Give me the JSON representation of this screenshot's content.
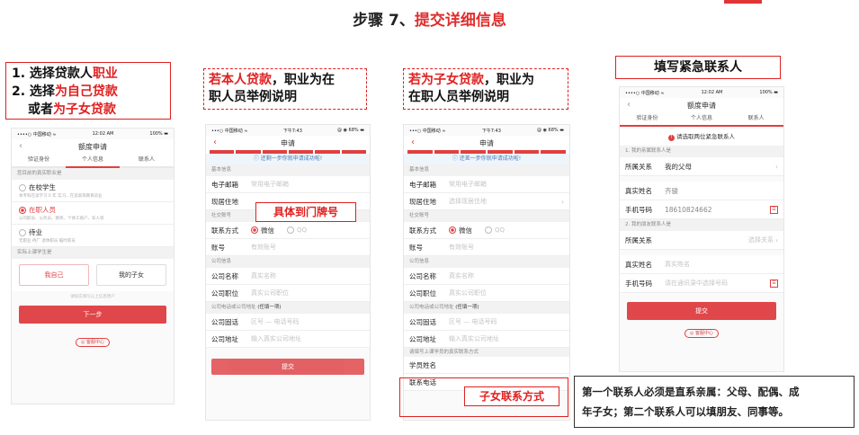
{
  "header": {
    "step": "步骤 7、",
    "title": "提交详细信息"
  },
  "callouts": {
    "c1_line1_pre": "1. 选择贷款人",
    "c1_line1_red": "职业",
    "c1_line2_pre": "2. 选择",
    "c1_line2_red": "为自己贷款",
    "c1_line3_pre": "或者",
    "c1_line3_red": "为子女贷款",
    "c2_red": "若本人贷款",
    "c2_rest1": "，职业为在",
    "c2_rest2": "职人员举例说明",
    "c3_red": "若为子女贷款",
    "c3_rest1": "，职业为",
    "c3_rest2": "在职人员举例说明",
    "c4": "填写紧急联系人",
    "address_hint": "具体到门牌号",
    "child_contact_hint": "子女联系方式",
    "note_line1": "第一个联系人必须是直系亲属：父母、配偶、成",
    "note_line2": "年子女；第二个联系人可以填朋友、同事等。"
  },
  "phone1": {
    "status_carrier": "••••○ 中国移动 ≈",
    "status_time": "12:02 AM",
    "status_battery": "100% ▬",
    "nav_title": "额度申请",
    "tabs": [
      "验证身份",
      "个人信息",
      "联系人"
    ],
    "section1": "您目前的真实职业是",
    "options": [
      {
        "title": "在校学生",
        "sub": "本专科在读学习 0 年   实习、在读高等教育毕业"
      },
      {
        "title": "在职人员",
        "sub": "公司职员、公务员、教师、个体工商户、军人等"
      },
      {
        "title": "待业",
        "sub": "无职业 待厂 退休职员 临时职员"
      }
    ],
    "section2": "实际上课学生是",
    "choice_self": "我自己",
    "choice_child": "我的子女",
    "small_hint": "请如实填写以上信息用户",
    "next_button": "下一步",
    "help": "◎ 客服中心"
  },
  "phone2": {
    "status_left": "•••○ 中国移动 ≈",
    "status_time": "下午7:43",
    "status_right": "@ ◉ 68% ▬",
    "nav_title": "申请",
    "notice": "ⓘ 还剩一步你就申请成功啦!",
    "sec_basic": "基本信息",
    "email_label": "电子邮箱",
    "email_ph": "常用电子邮箱",
    "address_label": "现居住地",
    "sec_social": "社交账号",
    "contact_label": "联系方式",
    "wechat": "微信",
    "qq": "QQ",
    "account_label": "账号",
    "account_ph": "有效账号",
    "sec_company": "公司信息",
    "company_name_label": "公司名称",
    "company_name_ph": "真实名称",
    "company_pos_label": "公司职位",
    "company_pos_ph": "真实公司职位",
    "sec_company_phone": "公司电话或公司地址",
    "sec_company_phone_tag": "(任填一项)",
    "company_tel_label": "公司固话",
    "company_tel_ph": "区号 — 电话号码",
    "company_addr_label": "公司地址",
    "company_addr_ph": "输入真实公司地址",
    "submit": "提交"
  },
  "phone3": {
    "status_left": "•••○ 中国移动 ≈",
    "status_time": "下午7:43",
    "status_right": "@ ◉ 68% ▬",
    "nav_title": "申请",
    "notice": "ⓘ 还差一步你就申请成功啦!",
    "sec_basic": "基本信息",
    "email_label": "电子邮箱",
    "email_ph": "常用电子邮箱",
    "address_label": "现居住地",
    "address_ph": "选择现居住地",
    "sec_social": "社交账号",
    "contact_label": "联系方式",
    "wechat": "微信",
    "qq": "QQ",
    "account_label": "账号",
    "account_ph": "有效账号",
    "sec_company": "公司信息",
    "company_name_label": "公司名称",
    "company_name_ph": "真实名称",
    "company_pos_label": "公司职位",
    "company_pos_ph": "真实公司职位",
    "sec_company_phone": "公司电话或公司地址",
    "sec_company_phone_tag": "(任填一项)",
    "company_tel_label": "公司固话",
    "company_tel_ph": "区号 — 电话号码",
    "company_addr_label": "公司地址",
    "company_addr_ph": "输入真实公司地址",
    "sec_student": "请填写上课学员的真实联系方式",
    "student_name_label": "学员姓名",
    "student_phone_label": "联系电话"
  },
  "phone4": {
    "status_carrier": "••••○ 中国移动 ≈",
    "status_time": "12:02 AM",
    "status_battery": "100% ▬",
    "nav_title": "额度申请",
    "tabs": [
      "验证身份",
      "个人信息",
      "联系人"
    ],
    "alert": "请选取两位紧急联系人",
    "sec1": "1. 我的亲属联系人是",
    "relation_label": "所属关系",
    "relation_value": "我的父母",
    "name_label": "真实姓名",
    "name_value": "齐骏",
    "phone_label": "手机号码",
    "phone_value": "18610824662",
    "sec2": "2. 我的朋友联系人是",
    "relation2_label": "所属关系",
    "relation2_ph": "选择关系",
    "name2_label": "真实姓名",
    "name2_ph": "真实姓名",
    "phone2_label": "手机号码",
    "phone2_ph": "请在通讯录中选择号码",
    "submit": "提交",
    "help": "◎ 客服中心"
  },
  "colors": {
    "accent": "#e02020",
    "button": "#e0474a"
  }
}
